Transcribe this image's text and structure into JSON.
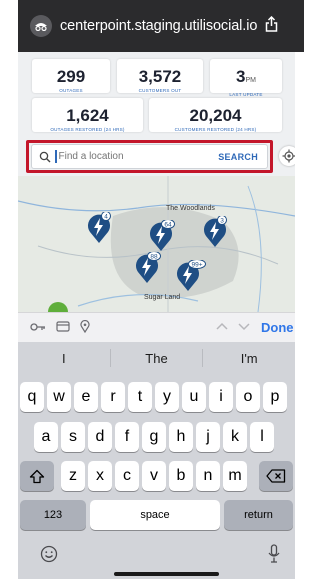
{
  "browser": {
    "url": "centerpoint.staging.utilisocial.io",
    "site_icon": "incognito-icon",
    "share_icon": "share-icon"
  },
  "stats": [
    {
      "value": "299",
      "label": "OUTAGES"
    },
    {
      "value": "3,572",
      "label": "CUSTOMERS OUT"
    },
    {
      "value": "3",
      "suffix": "PM",
      "label": "LAST UPDATE"
    },
    {
      "value": "1,624",
      "label": "OUTAGES RESTORED (24 HRS)"
    },
    {
      "value": "20,204",
      "label": "CUSTOMERS RESTORED (24 HRS)"
    }
  ],
  "search": {
    "placeholder": "Find a location",
    "button_label": "SEARCH"
  },
  "map": {
    "labels": [
      "The Woodlands",
      "Sugar Land"
    ],
    "pins": [
      {
        "count": "4"
      },
      {
        "count": "64"
      },
      {
        "count": "3"
      },
      {
        "count": "88"
      },
      {
        "count": "99+"
      }
    ]
  },
  "accessory": {
    "done_label": "Done"
  },
  "keyboard": {
    "suggestions": [
      "I",
      "The",
      "I'm"
    ],
    "row1": [
      "q",
      "w",
      "e",
      "r",
      "t",
      "y",
      "u",
      "i",
      "o",
      "p"
    ],
    "row2": [
      "a",
      "s",
      "d",
      "f",
      "g",
      "h",
      "j",
      "k",
      "l"
    ],
    "row3": [
      "z",
      "x",
      "c",
      "v",
      "b",
      "n",
      "m"
    ],
    "numbers_label": "123",
    "space_label": "space",
    "return_label": "return"
  },
  "colors": {
    "accent": "#2f69b8",
    "highlight": "#c3162a",
    "pin": "#1f4e84",
    "done": "#2f76e8"
  }
}
